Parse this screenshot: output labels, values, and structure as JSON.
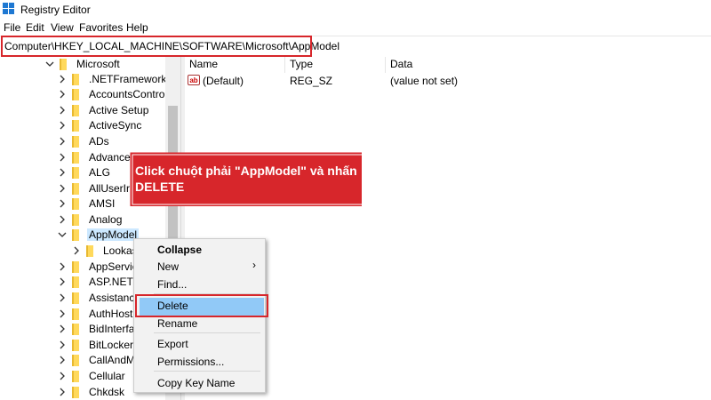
{
  "window": {
    "title": "Registry Editor"
  },
  "menu": [
    "File",
    "Edit",
    "View",
    "Favorites",
    "Help"
  ],
  "address": {
    "path": "Computer\\HKEY_LOCAL_MACHINE\\SOFTWARE\\Microsoft\\AppModel"
  },
  "tree": {
    "parent": "Microsoft",
    "items": [
      ".NETFramework",
      "AccountsControl",
      "Active Setup",
      "ActiveSync",
      "ADs",
      "Advance",
      "ALG",
      "AllUserIr",
      "AMSI",
      "Analog",
      "AppModel",
      "Lookasi",
      "AppService",
      "ASP.NET",
      "Assistance",
      "AuthHost",
      "BidInterfac",
      "BitLockerC",
      "CallAndMe",
      "Cellular",
      "Chkdsk"
    ]
  },
  "list": {
    "columns": [
      "Name",
      "Type",
      "Data"
    ],
    "rows": [
      {
        "name": "(Default)",
        "type": "REG_SZ",
        "data": "(value not set)"
      }
    ]
  },
  "context_menu": {
    "items": [
      "Collapse",
      "New",
      "Find...",
      "Delete",
      "Rename",
      "Export",
      "Permissions...",
      "Copy Key Name"
    ],
    "highlighted": "Delete"
  },
  "annotation": {
    "text": "Click chuột phải \"AppModel\" và nhấn DELETE"
  },
  "colors": {
    "accent_red": "#d7262b",
    "highlight_blue": "#91c9f7",
    "folder_yellow": "#ffd95c"
  }
}
